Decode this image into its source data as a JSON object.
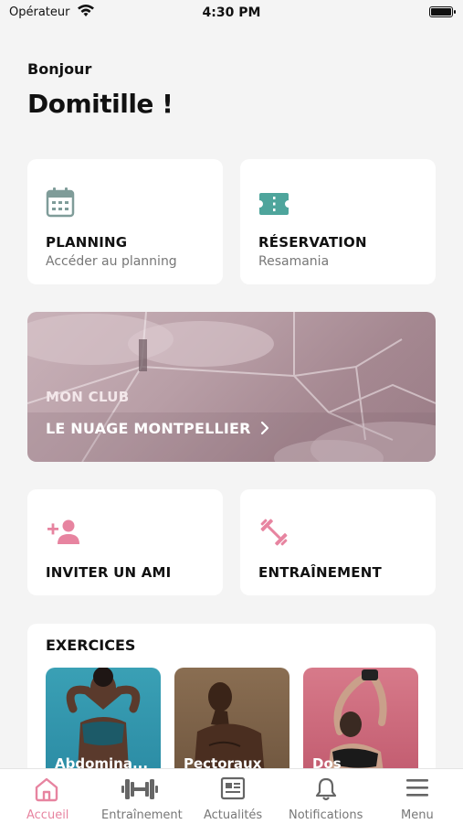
{
  "status": {
    "carrier": "Opérateur",
    "time": "4:30 PM"
  },
  "header": {
    "greeting": "Bonjour",
    "name": "Domitille !"
  },
  "cards": {
    "planning": {
      "title": "PLANNING",
      "subtitle": "Accéder au planning"
    },
    "reservation": {
      "title": "RÉSERVATION",
      "subtitle": "Resamania"
    },
    "invite": {
      "title": "INVITER UN AMI"
    },
    "training": {
      "title": "ENTRAÎNEMENT"
    }
  },
  "club": {
    "label": "MON CLUB",
    "name": "LE NUAGE MONTPELLIER"
  },
  "exercises": {
    "title": "EXERCICES",
    "items": [
      {
        "label": "Abdomina..."
      },
      {
        "label": "Pectoraux"
      },
      {
        "label": "Dos"
      }
    ]
  },
  "tabs": [
    {
      "label": "Accueil",
      "icon": "home-icon"
    },
    {
      "label": "Entraînement",
      "icon": "dumbbell-icon"
    },
    {
      "label": "Actualités",
      "icon": "news-icon"
    },
    {
      "label": "Notifications",
      "icon": "bell-icon"
    },
    {
      "label": "Menu",
      "icon": "menu-icon"
    }
  ],
  "colors": {
    "accent": "#e784a0",
    "teal": "#4ea59c",
    "muted": "#777777"
  }
}
